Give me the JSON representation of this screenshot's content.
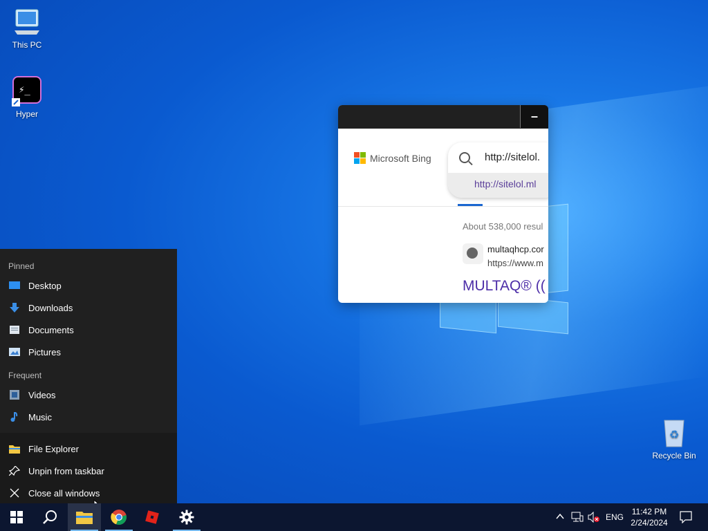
{
  "desktop": {
    "icons": [
      {
        "label": "This PC",
        "icon": "monitor-icon"
      },
      {
        "label": "Hyper",
        "icon": "terminal-icon"
      },
      {
        "label": "Recycle Bin",
        "icon": "recycle-bin-icon"
      }
    ]
  },
  "browser": {
    "minimize_label": "–",
    "logo_text": "Microsoft Bing",
    "search_value": "http://sitelol.",
    "suggestion": "http://sitelol.ml",
    "result_count": "About 538,000 resul",
    "result": {
      "site_name": "multaqhcp.cor",
      "site_url": "https://www.m",
      "title": "MULTAQ® (("
    },
    "colors": {
      "title_link": "#4d2ea8",
      "suggestion": "#5a3e99",
      "accent": "#1a66d0"
    }
  },
  "jumplist": {
    "pinned_header": "Pinned",
    "pinned": [
      {
        "label": "Desktop",
        "icon": "desktop-folder-icon"
      },
      {
        "label": "Downloads",
        "icon": "download-arrow-icon"
      },
      {
        "label": "Documents",
        "icon": "documents-icon"
      },
      {
        "label": "Pictures",
        "icon": "pictures-icon"
      }
    ],
    "frequent_header": "Frequent",
    "frequent": [
      {
        "label": "Videos",
        "icon": "videos-icon"
      },
      {
        "label": "Music",
        "icon": "music-note-icon"
      }
    ],
    "actions": [
      {
        "label": "File Explorer",
        "icon": "folder-icon"
      },
      {
        "label": "Unpin from taskbar",
        "icon": "unpin-icon"
      },
      {
        "label": "Close all windows",
        "icon": "close-icon"
      }
    ]
  },
  "taskbar": {
    "apps": [
      "start-icon",
      "search-icon",
      "file-explorer-icon",
      "chrome-icon",
      "roblox-icon",
      "settings-icon"
    ],
    "tray": {
      "language": "ENG",
      "time": "11:42 PM",
      "date": "2/24/2024"
    }
  }
}
